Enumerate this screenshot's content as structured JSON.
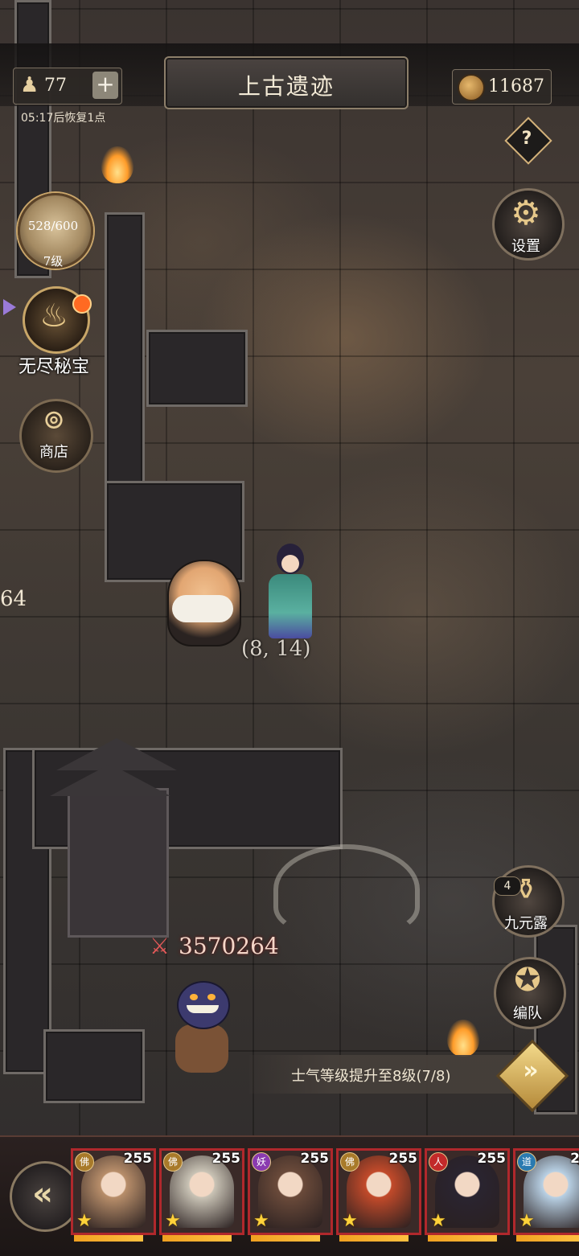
{
  "header": {
    "stamina": "77",
    "plus_label": "+",
    "recover_text": "05:17后恢复1点",
    "title": "上古遗迹",
    "coins": "11687",
    "help_label": "?"
  },
  "left_menu": {
    "progress_text": "528/600",
    "level_text": "7级",
    "treasure_label": "无尽秘宝",
    "shop_label": "商店",
    "edge_number": "64"
  },
  "right_menu": {
    "settings_label": "设置",
    "dew_label": "九元露",
    "dew_count": "4",
    "formation_label": "编队"
  },
  "map": {
    "coordinate": "(8, 14)",
    "enemy_power": "3570264"
  },
  "quest": {
    "text": "士气等级提升至8级(7/8)",
    "arrow_label": "»"
  },
  "team": {
    "back_label": "«",
    "heroes": [
      {
        "level": "255",
        "faction": "佛",
        "stars": "★",
        "color": "#b88e6a",
        "hp": 1.0
      },
      {
        "level": "255",
        "faction": "佛",
        "stars": "★",
        "color": "#c9c3b5",
        "hp": 1.0
      },
      {
        "level": "255",
        "faction": "妖",
        "stars": "★",
        "color": "#6a4a3a",
        "hp": 1.0
      },
      {
        "level": "255",
        "faction": "佛",
        "stars": "★",
        "color": "#c24a2a",
        "hp": 1.0
      },
      {
        "level": "255",
        "faction": "人",
        "stars": "★",
        "color": "#2a2430",
        "hp": 1.0
      },
      {
        "level": "2",
        "faction": "道",
        "stars": "★",
        "color": "#b8d0e4",
        "hp": 1.0
      }
    ]
  },
  "colors": {
    "accent_gold": "#e6c88a",
    "hero_border": "#b0282c",
    "power_red": "#e05858"
  }
}
